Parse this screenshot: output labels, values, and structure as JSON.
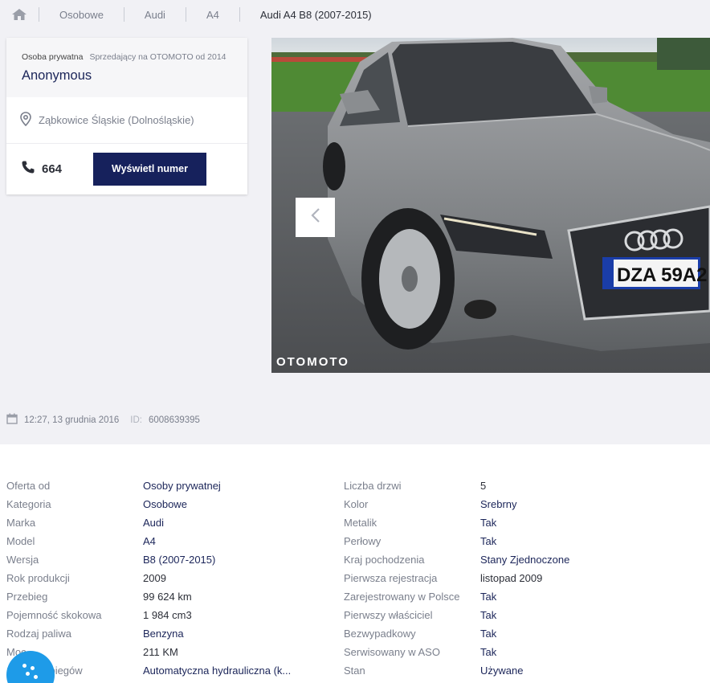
{
  "breadcrumb": {
    "items": [
      "Osobowe",
      "Audi",
      "A4"
    ],
    "current": "Audi A4 B8 (2007-2015)"
  },
  "seller": {
    "type": "Osoba prywatna",
    "since": "Sprzedający na OTOMOTO od 2014",
    "name": "Anonymous",
    "location": "Ząbkowice Śląskie (Dolnośląskie)",
    "phone_partial": "664",
    "show_number_label": "Wyświetl numer"
  },
  "gallery": {
    "watermark": "OTOMOTO",
    "plate": "DZA 59A2"
  },
  "meta": {
    "date": "12:27, 13 grudnia 2016",
    "id_label": "ID:",
    "id_value": "6008639395"
  },
  "params_left": [
    {
      "label": "Oferta od",
      "value": "Osoby prywatnej"
    },
    {
      "label": "Kategoria",
      "value": "Osobowe"
    },
    {
      "label": "Marka",
      "value": "Audi"
    },
    {
      "label": "Model",
      "value": "A4"
    },
    {
      "label": "Wersja",
      "value": "B8 (2007-2015)"
    },
    {
      "label": "Rok produkcji",
      "value": "2009"
    },
    {
      "label": "Przebieg",
      "value": "99 624 km"
    },
    {
      "label": "Pojemność skokowa",
      "value": "1 984 cm3"
    },
    {
      "label": "Rodzaj paliwa",
      "value": "Benzyna"
    },
    {
      "label": "Moc",
      "value": "211 KM"
    },
    {
      "label": "Skrzynia biegów",
      "value": "Automatyczna hydrauliczna (k..."
    }
  ],
  "params_right": [
    {
      "label": "Liczba drzwi",
      "value": "5"
    },
    {
      "label": "Kolor",
      "value": "Srebrny"
    },
    {
      "label": "Metalik",
      "value": "Tak"
    },
    {
      "label": "Perłowy",
      "value": "Tak"
    },
    {
      "label": "Kraj pochodzenia",
      "value": "Stany Zjednoczone"
    },
    {
      "label": "Pierwsza rejestracja",
      "value": "listopad 2009"
    },
    {
      "label": "Zarejestrowany w Polsce",
      "value": "Tak"
    },
    {
      "label": "Pierwszy właściciel",
      "value": "Tak"
    },
    {
      "label": "Bezwypadkowy",
      "value": "Tak"
    },
    {
      "label": "Serwisowany w ASO",
      "value": "Tak"
    },
    {
      "label": "Stan",
      "value": "Używane"
    }
  ],
  "colors": {
    "navy": "#16215c",
    "background": "#f1f1f5",
    "chat": "#1e9be8"
  }
}
